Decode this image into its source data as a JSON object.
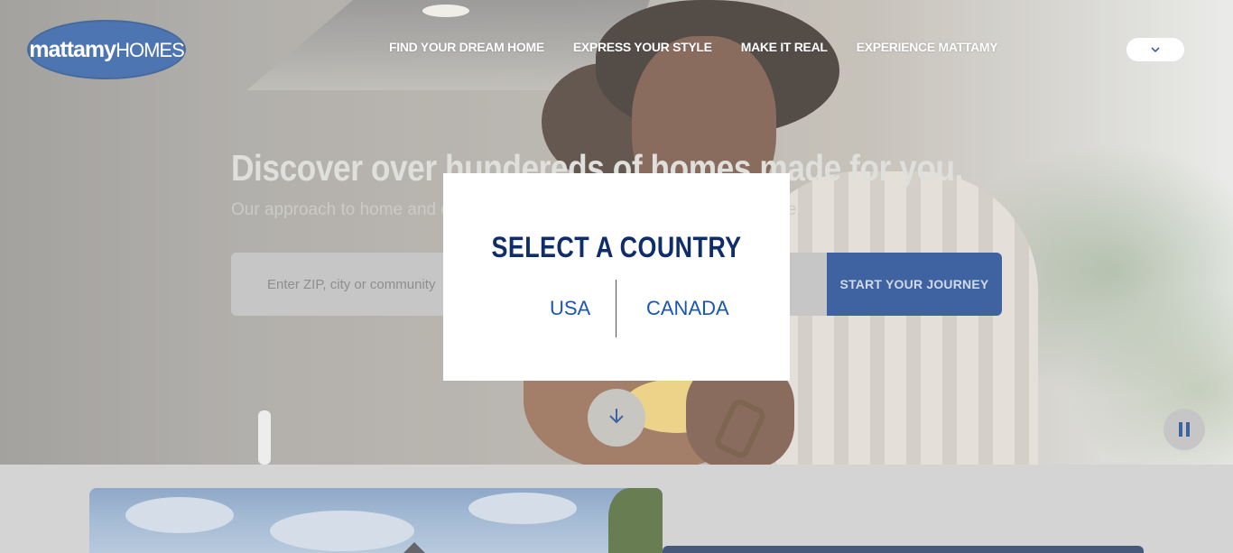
{
  "header": {
    "logo": {
      "brand": "mattamy",
      "suffix": "HOMES"
    },
    "nav": [
      {
        "label": "FIND YOUR DREAM HOME"
      },
      {
        "label": "EXPRESS YOUR STYLE"
      },
      {
        "label": "MAKE IT REAL"
      },
      {
        "label": "EXPERIENCE MATTAMY"
      }
    ],
    "country_selector_icon": "chevron-down-icon"
  },
  "hero": {
    "title": "Discover over hundereds of homes made for you.",
    "subtitle": "Our approach to home and community design makes sure you already live.",
    "search": {
      "placeholder": "Enter ZIP, city or community"
    },
    "cta_label": "START YOUR JOURNEY",
    "scroll_icon": "arrow-down-icon",
    "pause_icon": "pause-icon"
  },
  "modal": {
    "title": "SELECT A COUNTRY",
    "options": [
      {
        "label": "USA"
      },
      {
        "label": "CANADA"
      }
    ]
  },
  "colors": {
    "brand_blue": "#0a3687",
    "modal_title": "#0f2d6b",
    "link_blue": "#1a56b5"
  }
}
